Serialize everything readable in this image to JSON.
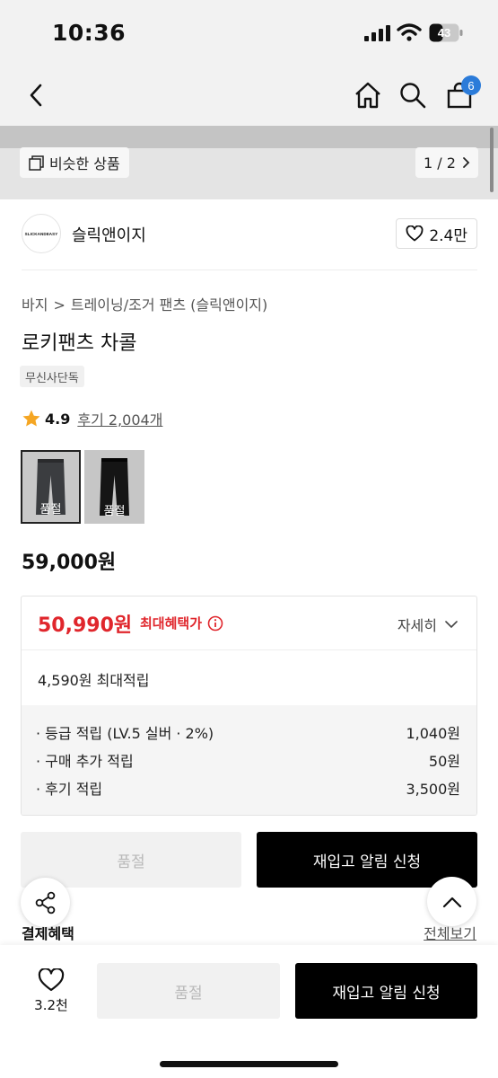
{
  "status_bar": {
    "time": "10:36",
    "battery": "43"
  },
  "nav": {
    "cart_count": "6"
  },
  "gallery": {
    "similar_label": "비슷한 상품",
    "page_indicator": "1 / 2"
  },
  "brand": {
    "logo_text": "SLICKANDEASY",
    "name": "슬릭앤이지",
    "likes": "2.4만"
  },
  "breadcrumb": {
    "items": [
      "바지",
      "트레이닝/조거 팬츠 (슬릭앤이지)"
    ],
    "separator": ">"
  },
  "product": {
    "title": "로키팬츠 차콜",
    "badge": "무신사단독",
    "rating": "4.9",
    "reviews": "후기 2,004개",
    "options": [
      {
        "label": "품절",
        "color": "charcoal",
        "selected": true
      },
      {
        "label": "품절",
        "color": "black",
        "selected": false
      }
    ],
    "price": "59,000원"
  },
  "benefit": {
    "max_price": "50,990원",
    "max_label": "최대혜택가",
    "detail_label": "자세히",
    "points_max": "4,590원 최대적립",
    "points": [
      {
        "label": "· 등급 적립 (LV.5 실버 · 2%)",
        "value": "1,040원"
      },
      {
        "label": "· 구매 추가 적립",
        "value": "50원"
      },
      {
        "label": "· 후기 적립",
        "value": "3,500원"
      }
    ]
  },
  "actions": {
    "soldout_label": "품절",
    "restock_label": "재입고 알림 신청"
  },
  "payment": {
    "title": "결제혜택",
    "view_all": "전체보기"
  },
  "bottom_bar": {
    "wish_count": "3.2천",
    "soldout_label": "품절",
    "restock_label": "재입고 알림 신청"
  },
  "colors": {
    "accent_red": "#e0262c",
    "badge_blue": "#2b7bd9",
    "star": "#f5a623",
    "black": "#000000"
  }
}
